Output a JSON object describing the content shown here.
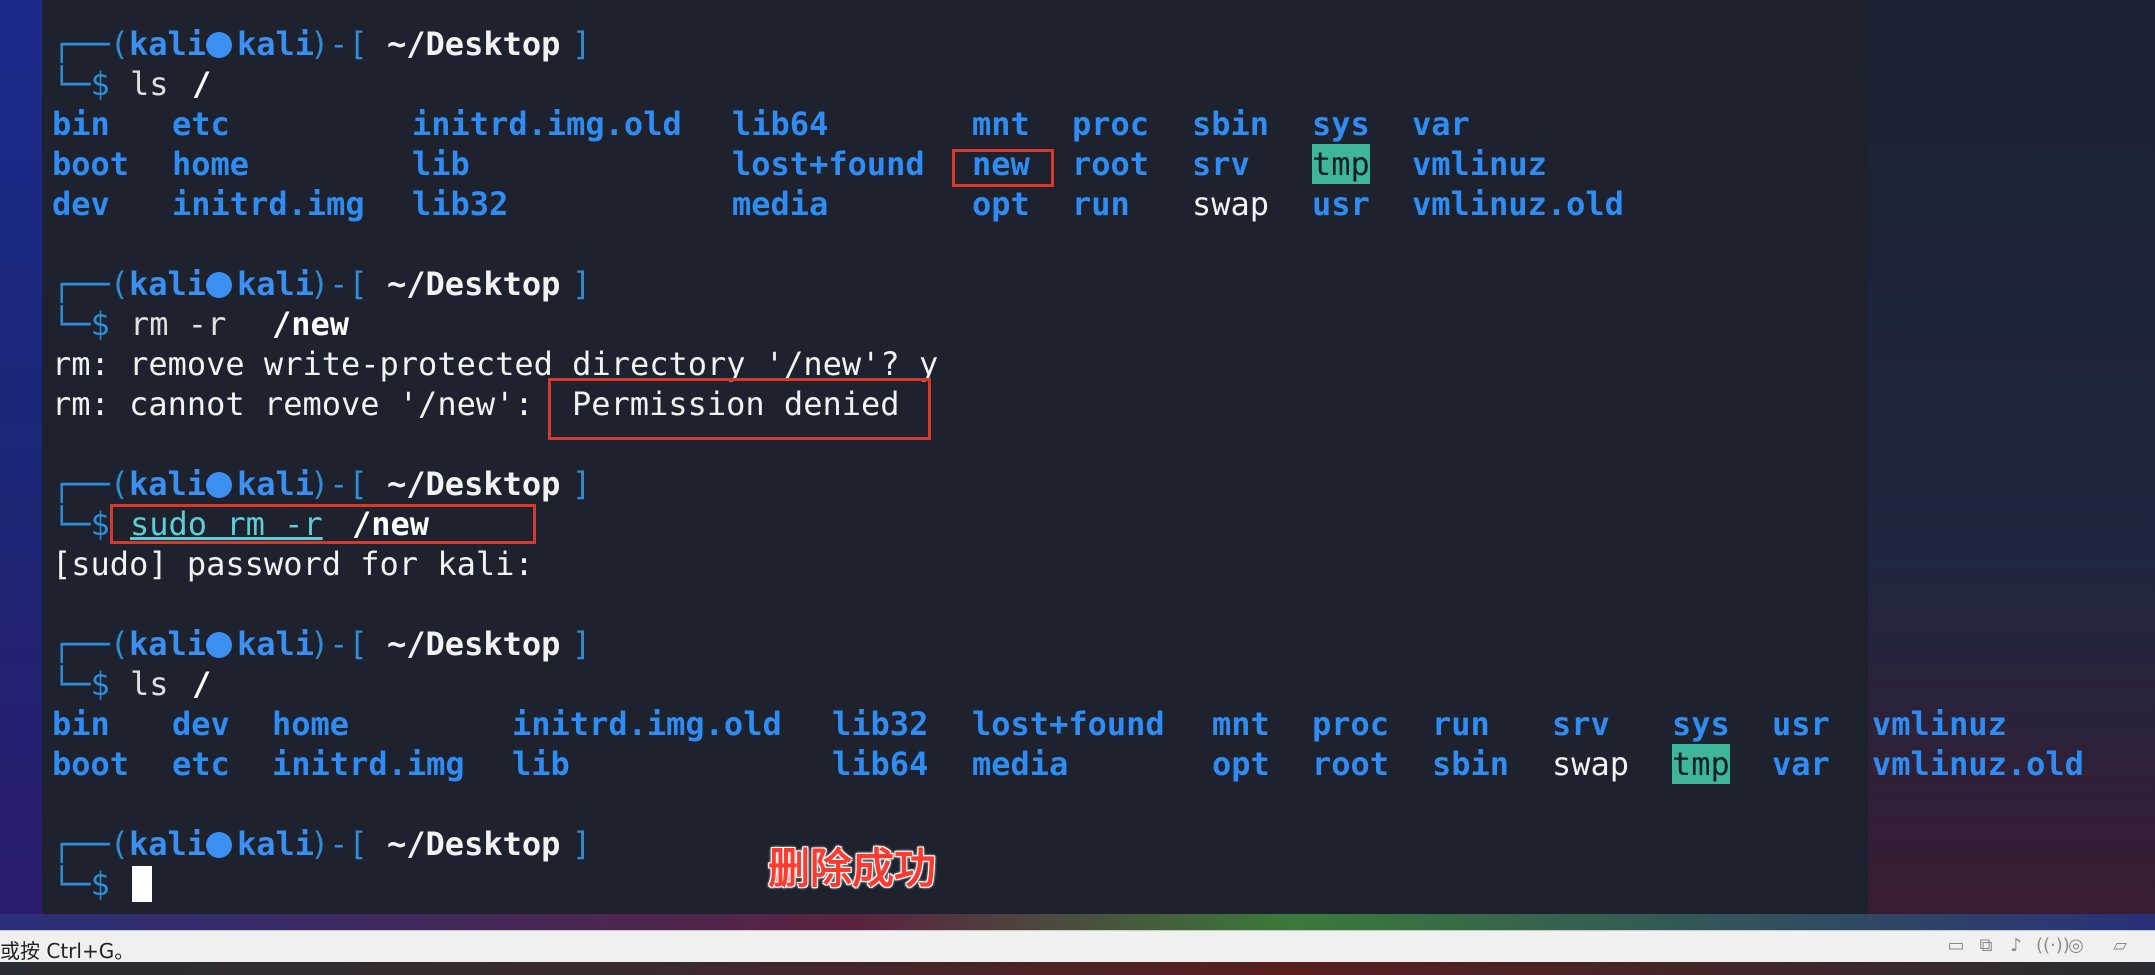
{
  "prompt": {
    "frame_left": "┌──(",
    "user": "kali",
    "host": "kali",
    "frame_mid": ")-[",
    "path": "~/Desktop",
    "frame_right": "]",
    "dollar": "└─$ "
  },
  "blocks": {
    "ls1": {
      "cmd": "ls",
      "arg": "/",
      "rows": [
        [
          "bin",
          "etc",
          "initrd.img.old",
          "lib64",
          "mnt",
          "proc",
          "sbin",
          "sys",
          "var"
        ],
        [
          "boot",
          "home",
          "lib",
          "lost+found",
          "new",
          "root",
          "srv",
          "tmp",
          "vmlinuz"
        ],
        [
          "dev",
          "initrd.img",
          "lib32",
          "media",
          "opt",
          "run",
          "swap",
          "usr",
          "vmlinuz.old"
        ]
      ]
    },
    "rm": {
      "cmd": "rm -r",
      "arg": "/new",
      "out1": "rm: remove write-protected directory '/new'? y",
      "out2_prefix": "rm: cannot remove '/new':",
      "out2_highlight": "Permission denied"
    },
    "sudo": {
      "sudo_text": "sudo rm -r",
      "arg": "/new",
      "out": "[sudo] password for kali:"
    },
    "ls2": {
      "cmd": "ls",
      "arg": "/",
      "rows": [
        [
          "bin",
          "dev",
          "home",
          "initrd.img.old",
          "lib32",
          "lost+found",
          "mnt",
          "proc",
          "run",
          "srv",
          "sys",
          "usr",
          "vmlinuz"
        ],
        [
          "boot",
          "etc",
          "initrd.img",
          "lib",
          "lib64",
          "media",
          "opt",
          "root",
          "sbin",
          "swap",
          "tmp",
          "var",
          "vmlinuz.old"
        ]
      ]
    }
  },
  "caption": "删除成功",
  "statusbar": {
    "text": "或按 Ctrl+G。",
    "icons": [
      "hdd-icon",
      "network-icon",
      "speaker-icon",
      "wireless-icon",
      "record-icon",
      "note-icon"
    ]
  }
}
